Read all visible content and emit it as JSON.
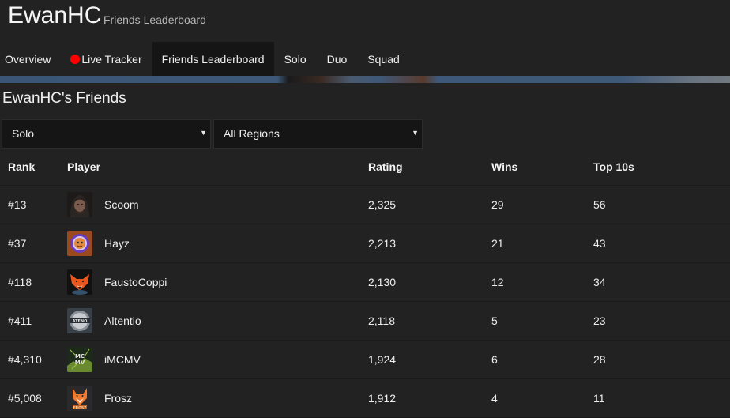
{
  "header": {
    "title": "EwanHC",
    "subtitle": "Friends Leaderboard"
  },
  "nav": {
    "tabs": [
      {
        "label": "Overview",
        "active": false
      },
      {
        "label": "Live Tracker",
        "active": false,
        "live_indicator_color": "#ff0000"
      },
      {
        "label": "Friends Leaderboard",
        "active": true
      },
      {
        "label": "Solo",
        "active": false
      },
      {
        "label": "Duo",
        "active": false
      },
      {
        "label": "Squad",
        "active": false
      }
    ]
  },
  "section": {
    "title": "EwanHC's Friends"
  },
  "filters": {
    "mode": {
      "selected": "Solo",
      "icon": "caret-down-icon"
    },
    "region": {
      "selected": "All Regions",
      "icon": "caret-down-icon"
    }
  },
  "table": {
    "columns": [
      "Rank",
      "Player",
      "Rating",
      "Wins",
      "Top 10s"
    ],
    "rows": [
      {
        "rank": "#13",
        "player": "Scoom",
        "avatar": "scoom-avatar",
        "rating": "2,325",
        "wins": "29",
        "top10s": "56"
      },
      {
        "rank": "#37",
        "player": "Hayz",
        "avatar": "hayz-avatar",
        "rating": "2,213",
        "wins": "21",
        "top10s": "43"
      },
      {
        "rank": "#118",
        "player": "FaustoCoppi",
        "avatar": "fox-avatar",
        "rating": "2,130",
        "wins": "12",
        "top10s": "34"
      },
      {
        "rank": "#411",
        "player": "Altentio",
        "avatar": "altentio-avatar",
        "rating": "2,118",
        "wins": "5",
        "top10s": "23"
      },
      {
        "rank": "#4,310",
        "player": "iMCMV",
        "avatar": "imcmv-avatar",
        "rating": "1,924",
        "wins": "6",
        "top10s": "28"
      },
      {
        "rank": "#5,008",
        "player": "Frosz",
        "avatar": "frosz-avatar",
        "rating": "1,912",
        "wins": "4",
        "top10s": "11"
      }
    ]
  },
  "colors": {
    "background": "#222222",
    "active_tab": "#151515",
    "live_dot": "#ff0000"
  }
}
